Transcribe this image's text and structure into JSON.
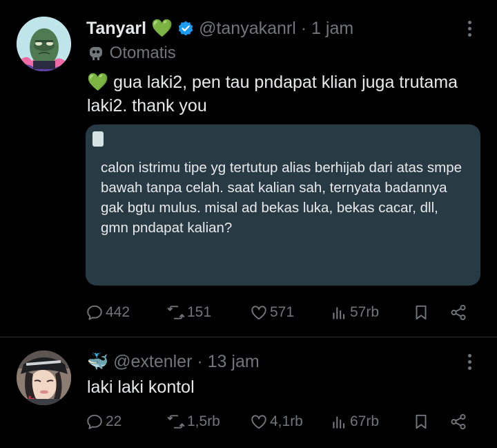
{
  "tweet1": {
    "name": "Tanyarl",
    "name_emoji": "💚",
    "handle": "@tanyakanrl",
    "time": "· 1 jam",
    "automated_label": "Otomatis",
    "text_line1_emoji": "💚",
    "text_line1": "gua laki2, pen tau pndapat klian juga trutama",
    "text_line2": "laki2. thank you",
    "quoted_text": "calon istrimu tipe yg tertutup alias berhijab dari atas smpe bawah tanpa celah. saat kalian sah, ternyata badannya gak bgtu mulus. misal ad bekas luka, bekas cacar, dll, gmn pndapat kalian?",
    "replies": "442",
    "retweets": "151",
    "likes": "571",
    "views": "57rb"
  },
  "tweet2": {
    "name_emoji": "🐳",
    "handle": "@extenler",
    "time": "· 13 jam",
    "text": "laki laki kontol",
    "replies": "22",
    "retweets": "1,5rb",
    "likes": "4,1rb",
    "views": "67rb"
  },
  "colors": {
    "background": "#000000",
    "text": "#e7e9ea",
    "muted": "#71767b",
    "card": "#283b45",
    "verified": "#1d9bf0",
    "green_heart": "#1fb356",
    "divider": "#2f3336"
  },
  "icons": [
    "robot-icon",
    "verified-badge-icon",
    "more-options-icon",
    "reply-icon",
    "retweet-icon",
    "like-icon",
    "views-icon",
    "bookmark-icon",
    "share-icon"
  ]
}
